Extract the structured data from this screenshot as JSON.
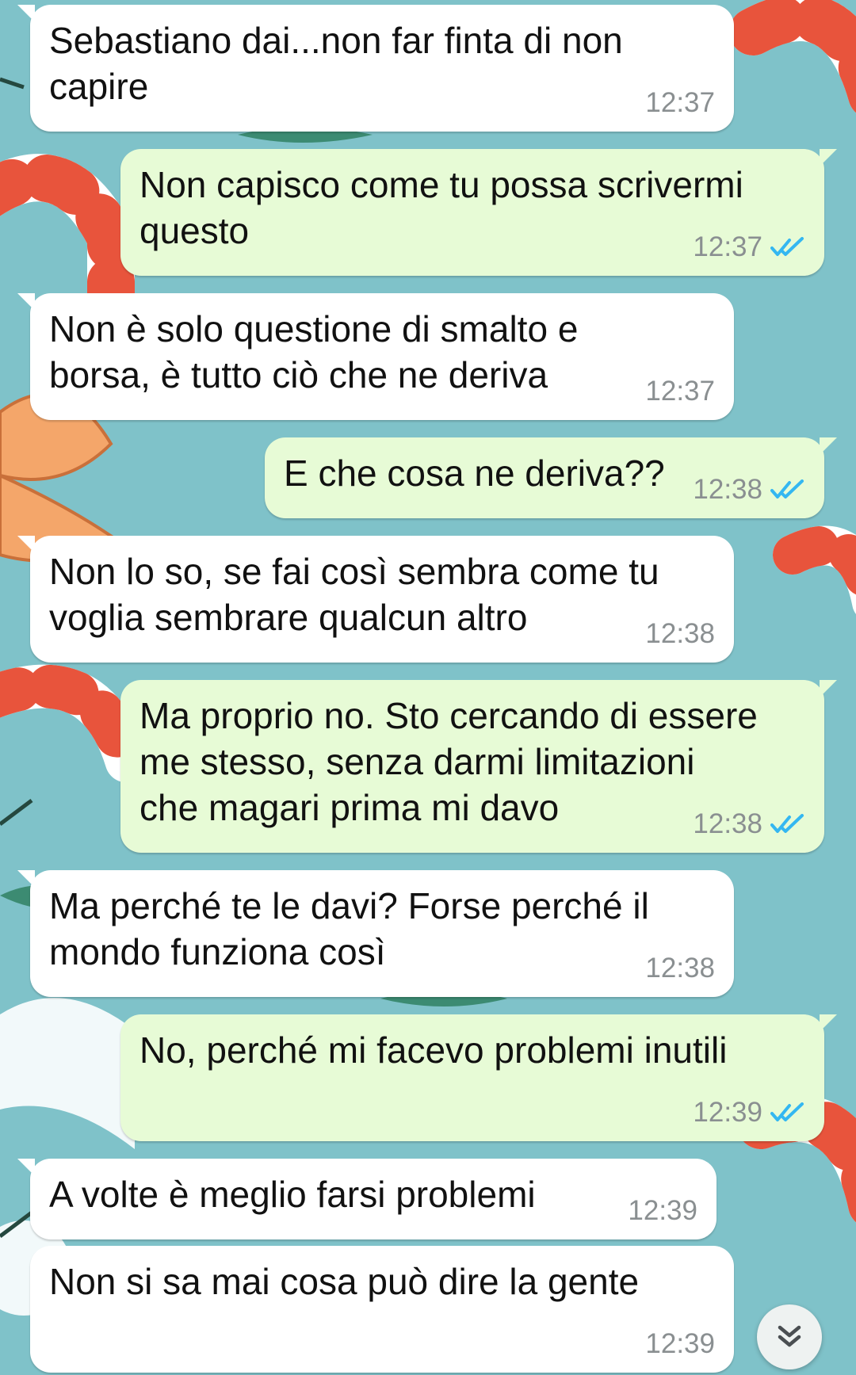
{
  "messages": [
    {
      "dir": "in",
      "text": "Sebastiano dai...non far finta di non\ncapire",
      "time": "12:37"
    },
    {
      "dir": "out",
      "text": "Non capisco come tu possa scrivermi\nquesto",
      "time": "12:37",
      "status": "read"
    },
    {
      "dir": "in",
      "text": "Non è solo questione di smalto e\nborsa, è tutto ciò che ne deriva",
      "time": "12:37"
    },
    {
      "dir": "out",
      "text": "E che cosa ne deriva??",
      "time": "12:38",
      "status": "read"
    },
    {
      "dir": "in",
      "text": "Non lo so, se fai così sembra come tu\nvoglia sembrare qualcun altro",
      "time": "12:38"
    },
    {
      "dir": "out",
      "text": "Ma proprio no. Sto cercando di essere\nme stesso, senza darmi limitazioni\nche magari prima mi davo",
      "time": "12:38",
      "status": "read"
    },
    {
      "dir": "in",
      "text": "Ma perché te le davi? Forse perché il\nmondo funziona così",
      "time": "12:38"
    },
    {
      "dir": "out",
      "text": "No, perché mi facevo problemi inutili",
      "time": "12:39",
      "status": "read"
    },
    {
      "dir": "in",
      "text": "A volte è meglio farsi problemi",
      "time": "12:39"
    },
    {
      "dir": "in",
      "text": "Non si sa mai cosa può dire la gente",
      "time": "12:39"
    }
  ],
  "colors": {
    "wallpaper": "#7fc2c9",
    "incoming_bubble": "#ffffff",
    "outgoing_bubble": "#e7fbd6",
    "read_ticks": "#34b7f1",
    "time_text": "#8a8f91"
  },
  "icons": {
    "read_status": "double-check-icon",
    "scroll_down": "double-chevron-down-icon"
  }
}
